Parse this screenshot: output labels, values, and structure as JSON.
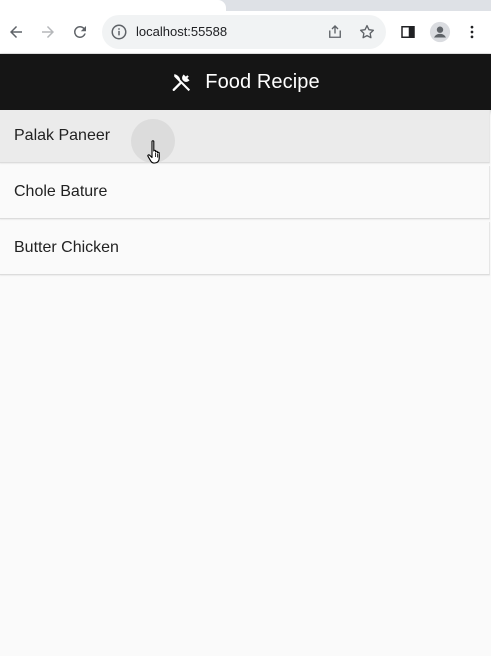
{
  "browser": {
    "url": "localhost:55588",
    "icons": {
      "back": "back-arrow-icon",
      "forward": "forward-arrow-icon",
      "reload": "reload-icon",
      "site_info": "info-icon",
      "share": "share-icon",
      "bookmark": "star-icon",
      "side_panel": "side-panel-icon",
      "profile": "profile-icon",
      "menu": "kebab-menu-icon"
    }
  },
  "appbar": {
    "title": "Food Recipe",
    "icon": "fork-knife-icon",
    "background": "#151515"
  },
  "recipes": [
    {
      "name": "Palak Paneer",
      "hovered": true
    },
    {
      "name": "Chole Bature",
      "hovered": false
    },
    {
      "name": "Butter Chicken",
      "hovered": false
    }
  ]
}
